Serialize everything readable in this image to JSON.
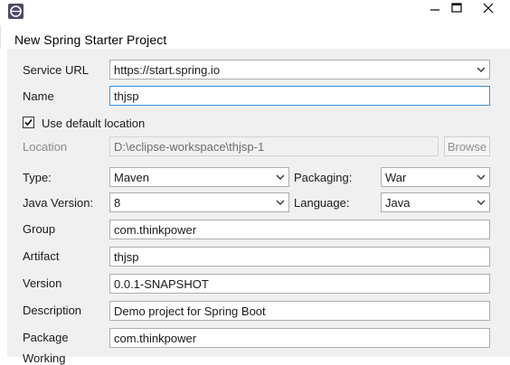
{
  "window": {
    "app_icon": "eclipse-icon",
    "controls": [
      "minimize-icon",
      "maximize-icon",
      "close-icon"
    ]
  },
  "header": {
    "title": "New Spring Starter Project"
  },
  "form": {
    "service_url": {
      "label": "Service URL",
      "value": "https://start.spring.io"
    },
    "name": {
      "label": "Name",
      "value": "thjsp"
    },
    "use_default_location": {
      "label": "Use default location",
      "checked": true
    },
    "location": {
      "label": "Location",
      "value": "D:\\eclipse-workspace\\thjsp-1",
      "browse_label": "Browse"
    },
    "type": {
      "label": "Type:",
      "value": "Maven"
    },
    "packaging": {
      "label": "Packaging:",
      "value": "War"
    },
    "java_version": {
      "label": "Java Version:",
      "value": "8"
    },
    "language": {
      "label": "Language:",
      "value": "Java"
    },
    "group": {
      "label": "Group",
      "value": "com.thinkpower"
    },
    "artifact": {
      "label": "Artifact",
      "value": "thjsp"
    },
    "version": {
      "label": "Version",
      "value": "0.0.1-SNAPSHOT"
    },
    "description": {
      "label": "Description",
      "value": "Demo project for Spring Boot"
    },
    "package": {
      "label": "Package",
      "value": "com.thinkpower"
    },
    "next_label_partial": "Working"
  }
}
